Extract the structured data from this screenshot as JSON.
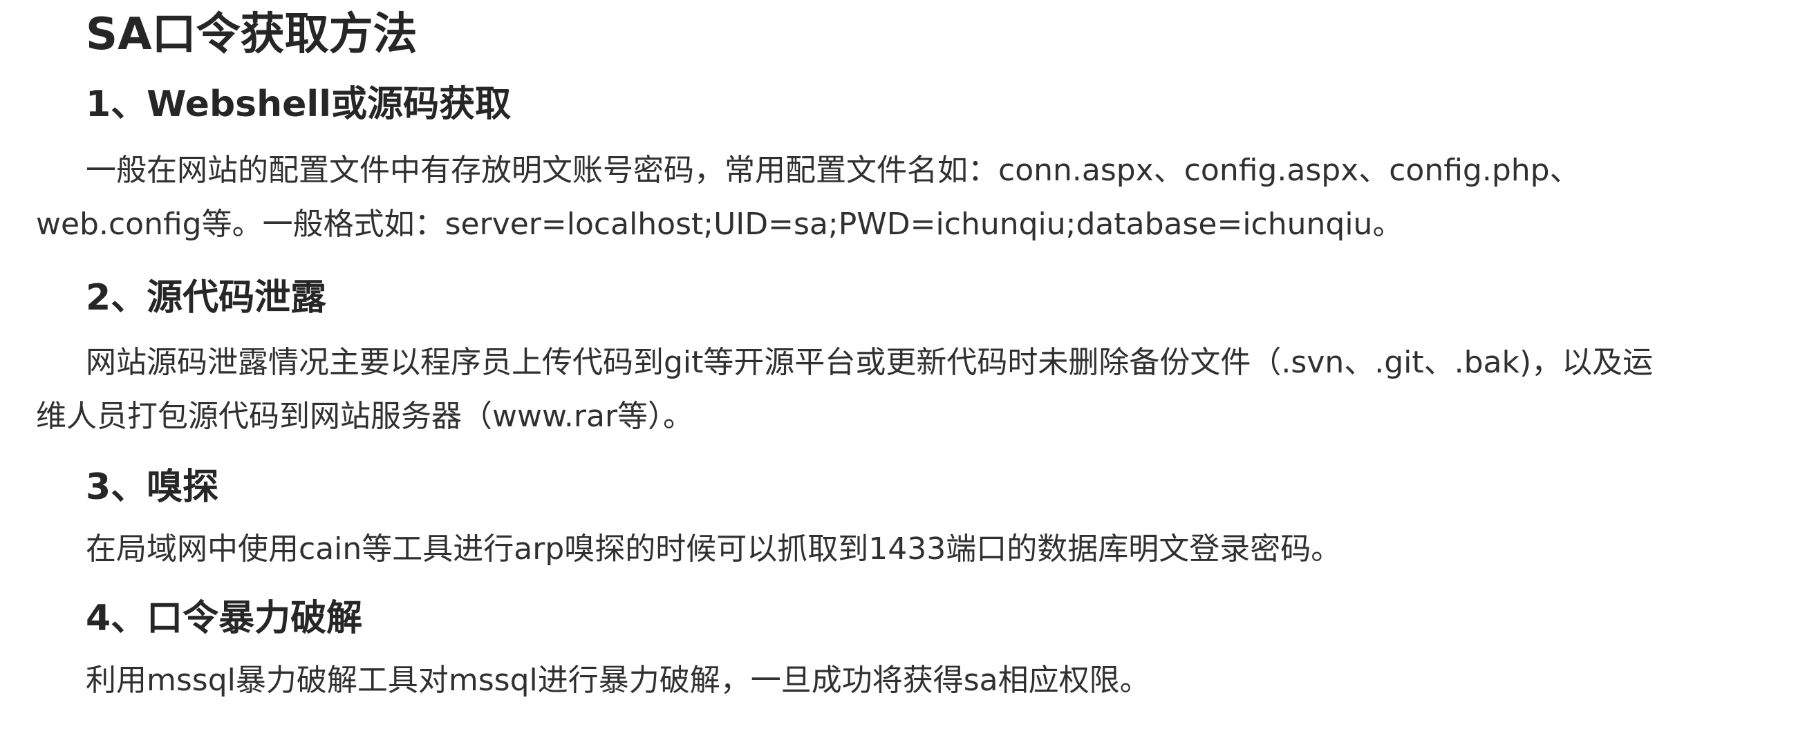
{
  "title": "SA口令获取方法",
  "sections": [
    {
      "heading": "1、Webshell或源码获取",
      "lines": [
        "一般在网站的配置文件中有存放明文账号密码，常用配置文件名如：conn.aspx、config.aspx、config.php、",
        "web.config等。一般格式如：server=localhost;UID=sa;PWD=ichunqiu;database=ichunqiu。"
      ]
    },
    {
      "heading": "2、源代码泄露",
      "lines": [
        "网站源码泄露情况主要以程序员上传代码到git等开源平台或更新代码时未删除备份文件（.svn、.git、.bak)，以及运",
        "维人员打包源代码到网站服务器（www.rar等）。"
      ]
    },
    {
      "heading": "3、嗅探",
      "lines": [
        "在局域网中使用cain等工具进行arp嗅探的时候可以抓取到1433端口的数据库明文登录密码。"
      ]
    },
    {
      "heading": "4、口令暴力破解",
      "lines": [
        "利用mssql暴力破解工具对mssql进行暴力破解，一旦成功将获得sa相应权限。"
      ]
    }
  ]
}
